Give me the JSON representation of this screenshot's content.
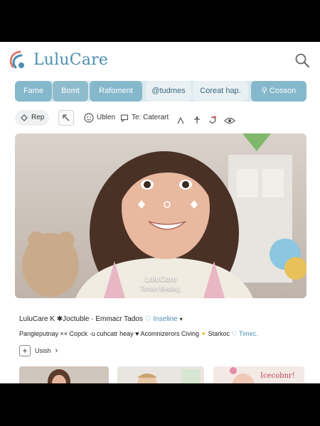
{
  "app": {
    "name": "LuluCare"
  },
  "tabs": [
    {
      "label": "Fame"
    },
    {
      "label": "Bomt"
    },
    {
      "label": "Rafoment"
    },
    {
      "label": "@tudmes"
    },
    {
      "label": "Coreat hap."
    },
    {
      "label": "Cosson"
    }
  ],
  "toolbar": {
    "rep_label": "Rep",
    "ublen_label": "Ublen",
    "caterart_label": "Te: Caterart"
  },
  "photo": {
    "caption_title": "LuluCare",
    "caption_sub": "Tortan Bedleg."
  },
  "meta": {
    "line1_prefix": "LuluCare K ✱Joctuble · Emmacr Tados",
    "line1_link": "Inseline",
    "line2_text": "Pangleputnay ×× Copck ·u cuhcatr heay ♥ Acomnizerors Civing",
    "line2_star": "Starkoc",
    "line2_link": "Timec."
  },
  "actions": {
    "add_label": "Usish"
  },
  "thumbnails": [
    {
      "label": ""
    },
    {
      "label": ""
    },
    {
      "label": "Icecobnr!"
    }
  ],
  "colors": {
    "brand": "#4a8fb0",
    "tab_active": "#8fbccd",
    "tab_bar": "#d9e8ee",
    "bezel": "#000000"
  },
  "icons": [
    "logo-icon",
    "search-icon",
    "rep-icon",
    "select-icon",
    "face-icon",
    "chat-icon",
    "emoji-icon",
    "pin-icon",
    "sync-icon",
    "eye-icon",
    "plus-icon",
    "chevron-right-icon",
    "heart-icon",
    "star-icon"
  ]
}
